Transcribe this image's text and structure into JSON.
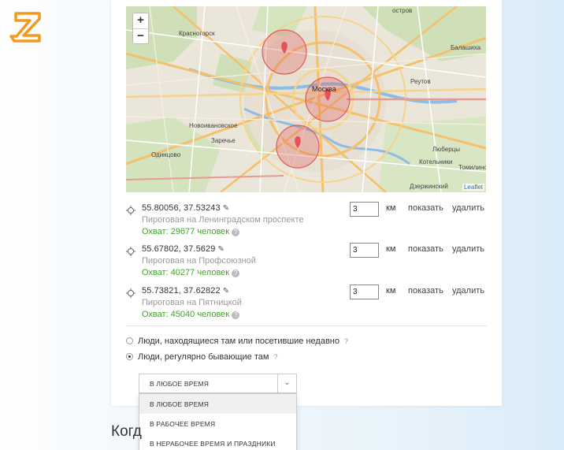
{
  "map": {
    "zoom_in": "+",
    "zoom_out": "−",
    "attribution": "Leaflet",
    "labels": [
      {
        "text": "остров",
        "cls": ""
      },
      {
        "text": "Балашиха",
        "cls": ""
      },
      {
        "text": "Красногорск",
        "cls": ""
      },
      {
        "text": "Москва",
        "cls": "city"
      },
      {
        "text": "Реутов",
        "cls": ""
      },
      {
        "text": "Новоивановское",
        "cls": ""
      },
      {
        "text": "Заречье",
        "cls": ""
      },
      {
        "text": "Одинцово",
        "cls": ""
      },
      {
        "text": "Люберцы",
        "cls": ""
      },
      {
        "text": "Котельники",
        "cls": ""
      },
      {
        "text": "Томилино",
        "cls": ""
      },
      {
        "text": "Дзержинский",
        "cls": ""
      }
    ]
  },
  "locations": [
    {
      "coords": "55.80056,   37.53243",
      "place": "Пироговая на Ленинградском проспекте",
      "reach": "Охват: 29677 человек",
      "radius": "3"
    },
    {
      "coords": "55.67802,   37.5629",
      "place": "Пироговая на Профсоюзной",
      "reach": "Охват: 40277 человек",
      "radius": "3"
    },
    {
      "coords": "55.73821,   37.62822",
      "place": "Пироговая на Пятницкой",
      "reach": "Охват: 45040 человек",
      "radius": "3"
    }
  ],
  "labels": {
    "km": "км",
    "show": "показать",
    "delete": "удалить",
    "help": "?"
  },
  "audience": {
    "option1": "Люди, находящиеся там или посетившие недавно",
    "option2": "Люди, регулярно бывающие там",
    "help": "?",
    "selected": 2
  },
  "time_select": {
    "value": "В ЛЮБОЕ ВРЕМЯ",
    "arrow": "⌄",
    "options": [
      "В ЛЮБОЕ ВРЕМЯ",
      "В РАБОЧЕЕ ВРЕМЯ",
      "В НЕРАБОЧЕЕ ВРЕМЯ И ПРАЗДНИКИ"
    ]
  },
  "section_heading": "Когд",
  "colors": {
    "accent_orange": "#f29a1f",
    "reach_green": "#3aa91d",
    "circle_red": "#e05a5a",
    "link_blue": "#2b7fd1"
  }
}
